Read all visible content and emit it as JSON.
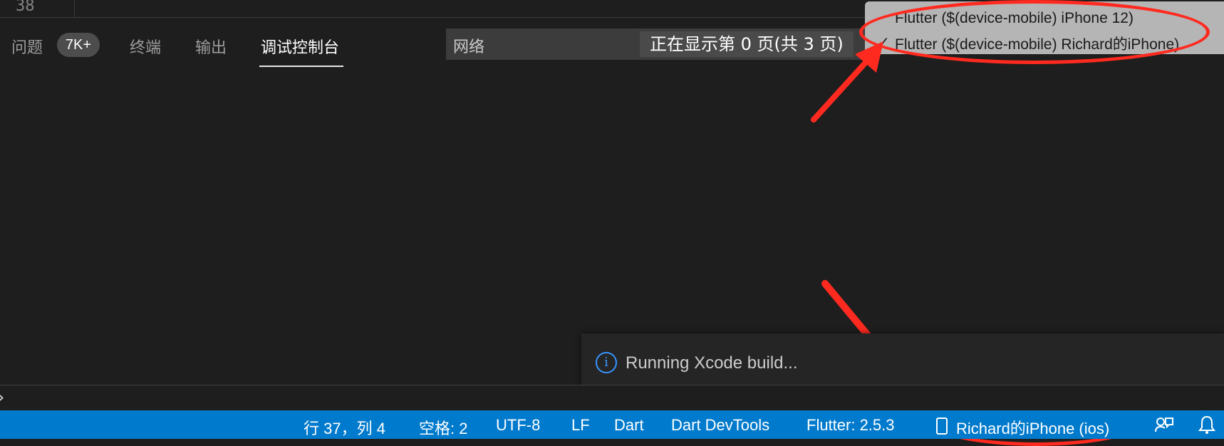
{
  "editor": {
    "line_number": "38"
  },
  "panel": {
    "tabs": [
      {
        "label": "问题"
      },
      {
        "label": "终端"
      },
      {
        "label": "输出"
      },
      {
        "label": "调试控制台"
      }
    ],
    "problems_badge": "7K+",
    "active_tab": "调试控制台",
    "select_value": "网络",
    "page_indicator": "正在显示第 0 页(共 3 页)"
  },
  "device_menu": {
    "items": [
      {
        "label": "Flutter ($(device-mobile) iPhone 12)",
        "checked": false
      },
      {
        "label": "Flutter ($(device-mobile) Richard的iPhone)",
        "checked": true
      }
    ],
    "check_glyph": "✓"
  },
  "notification": {
    "icon": "info-icon",
    "text": "Running Xcode build..."
  },
  "input_prompt": "›",
  "status_bar": {
    "cursor_position": "行 37，列 4",
    "indentation": "空格: 2",
    "encoding": "UTF-8",
    "eol": "LF",
    "language": "Dart",
    "devtools": "Dart DevTools",
    "flutter_version": "Flutter: 2.5.3",
    "device": "Richard的iPhone (ios)"
  },
  "colors": {
    "status_bar_bg": "#007acc",
    "panel_bg": "#1e1e1e",
    "annotation": "#ff2a1f",
    "info_blue": "#3794ff"
  }
}
